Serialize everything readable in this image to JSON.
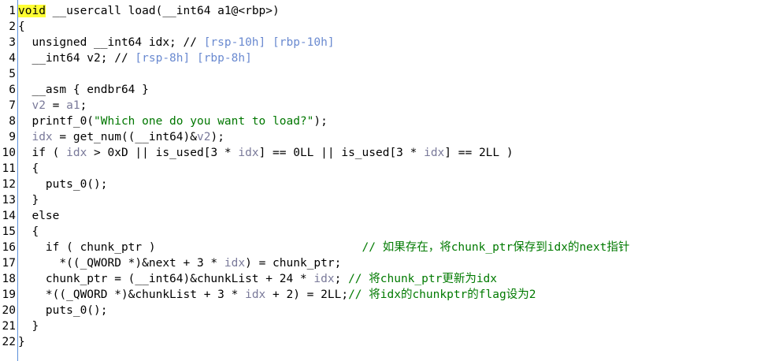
{
  "lines": [
    {
      "n": "1",
      "segs": [
        {
          "t": "void",
          "c": "kw-hl"
        },
        {
          "t": " __usercall load(__int64 a1@<rbp>)",
          "c": ""
        }
      ]
    },
    {
      "n": "2",
      "segs": [
        {
          "t": "{",
          "c": ""
        }
      ]
    },
    {
      "n": "3",
      "segs": [
        {
          "t": "  unsigned __int64 idx; // ",
          "c": ""
        },
        {
          "t": "[rsp-10h] [rbp-10h]",
          "c": "cmt-grey"
        }
      ]
    },
    {
      "n": "4",
      "segs": [
        {
          "t": "  __int64 v2; // ",
          "c": ""
        },
        {
          "t": "[rsp-8h] [rbp-8h]",
          "c": "cmt-grey"
        }
      ]
    },
    {
      "n": "5",
      "segs": [
        {
          "t": "",
          "c": ""
        }
      ]
    },
    {
      "n": "6",
      "segs": [
        {
          "t": "  __asm { endbr64 }",
          "c": ""
        }
      ]
    },
    {
      "n": "7",
      "segs": [
        {
          "t": "  ",
          "c": ""
        },
        {
          "t": "v2",
          "c": "vgrey"
        },
        {
          "t": " = ",
          "c": ""
        },
        {
          "t": "a1",
          "c": "vgrey"
        },
        {
          "t": ";",
          "c": ""
        }
      ]
    },
    {
      "n": "8",
      "segs": [
        {
          "t": "  printf_0(",
          "c": ""
        },
        {
          "t": "\"Which one do you want to load?\"",
          "c": "str"
        },
        {
          "t": ");",
          "c": ""
        }
      ]
    },
    {
      "n": "9",
      "segs": [
        {
          "t": "  ",
          "c": ""
        },
        {
          "t": "idx",
          "c": "vgrey"
        },
        {
          "t": " = get_num((__int64)&",
          "c": ""
        },
        {
          "t": "v2",
          "c": "vgrey"
        },
        {
          "t": ");",
          "c": ""
        }
      ]
    },
    {
      "n": "10",
      "segs": [
        {
          "t": "  if ( ",
          "c": ""
        },
        {
          "t": "idx",
          "c": "vgrey"
        },
        {
          "t": " > 0xD || is_used[3 * ",
          "c": ""
        },
        {
          "t": "idx",
          "c": "vgrey"
        },
        {
          "t": "] == 0LL || is_used[3 * ",
          "c": ""
        },
        {
          "t": "idx",
          "c": "vgrey"
        },
        {
          "t": "] == 2LL )",
          "c": ""
        }
      ]
    },
    {
      "n": "11",
      "segs": [
        {
          "t": "  {",
          "c": ""
        }
      ]
    },
    {
      "n": "12",
      "segs": [
        {
          "t": "    puts_0();",
          "c": ""
        }
      ]
    },
    {
      "n": "13",
      "segs": [
        {
          "t": "  }",
          "c": ""
        }
      ]
    },
    {
      "n": "14",
      "segs": [
        {
          "t": "  else",
          "c": ""
        }
      ]
    },
    {
      "n": "15",
      "segs": [
        {
          "t": "  {",
          "c": ""
        }
      ]
    },
    {
      "n": "16",
      "segs": [
        {
          "t": "    if ( chunk_ptr )                              ",
          "c": ""
        },
        {
          "t": "// 如果存在，将chunk_ptr保存到idx的next指针",
          "c": "comment"
        }
      ]
    },
    {
      "n": "17",
      "segs": [
        {
          "t": "      *((_QWORD *)&next + 3 * ",
          "c": ""
        },
        {
          "t": "idx",
          "c": "vgrey"
        },
        {
          "t": ") = chunk_ptr;",
          "c": ""
        }
      ]
    },
    {
      "n": "18",
      "segs": [
        {
          "t": "    chunk_ptr = (__int64)&chunkList + 24 * ",
          "c": ""
        },
        {
          "t": "idx",
          "c": "vgrey"
        },
        {
          "t": "; ",
          "c": ""
        },
        {
          "t": "// 将chunk_ptr更新为idx",
          "c": "comment"
        }
      ]
    },
    {
      "n": "19",
      "segs": [
        {
          "t": "    *((_QWORD *)&chunkList + 3 * ",
          "c": ""
        },
        {
          "t": "idx",
          "c": "vgrey"
        },
        {
          "t": " + 2) = 2LL;",
          "c": ""
        },
        {
          "t": "// 将idx的chunkptr的flag设为2",
          "c": "comment"
        }
      ]
    },
    {
      "n": "20",
      "segs": [
        {
          "t": "    puts_0();",
          "c": ""
        }
      ]
    },
    {
      "n": "21",
      "segs": [
        {
          "t": "  }",
          "c": ""
        }
      ]
    },
    {
      "n": "22",
      "segs": [
        {
          "t": "}",
          "c": ""
        }
      ]
    }
  ]
}
